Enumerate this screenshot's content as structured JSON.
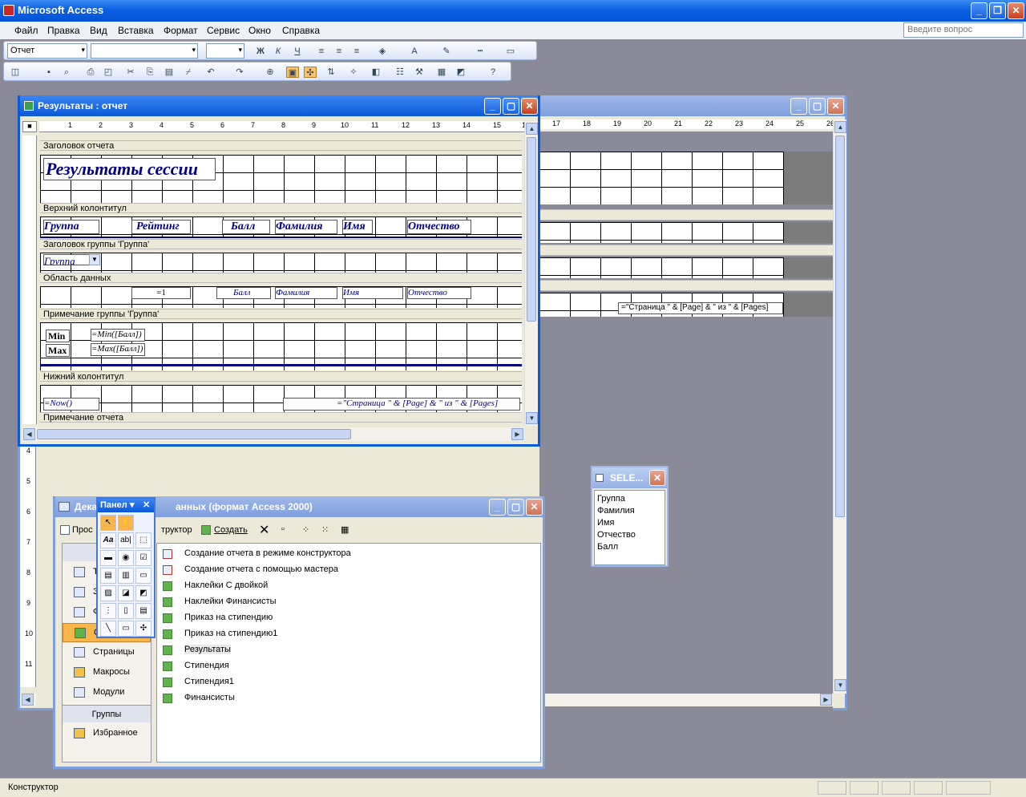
{
  "app": {
    "title": "Microsoft Access",
    "ask_placeholder": "Введите вопрос"
  },
  "menu": [
    "Файл",
    "Правка",
    "Вид",
    "Вставка",
    "Формат",
    "Сервис",
    "Окно",
    "Справка"
  ],
  "toolbar": {
    "object_combo": "Отчет"
  },
  "report_window": {
    "title": "Результаты : отчет",
    "ruler_numbers": [
      "1",
      "2",
      "3",
      "4",
      "5",
      "6",
      "7",
      "8",
      "9",
      "10",
      "11",
      "12",
      "13",
      "14",
      "15",
      "16",
      "17",
      "18",
      "19",
      "20",
      "21",
      "22",
      "23",
      "24",
      "25",
      "26"
    ],
    "sections": {
      "report_header": "Заголовок отчета",
      "page_header": "Верхний колонтитул",
      "group_header": "Заголовок группы 'Группа'",
      "detail": "Область данных",
      "group_footer": "Примечание группы 'Группа'",
      "page_footer": "Нижний колонтитул",
      "report_footer": "Примечание отчета"
    },
    "title_label": "Результаты сессии",
    "page_header_labels": [
      "Группа",
      "Рейтинг",
      "Балл",
      "Фамилия",
      "Имя",
      "Отчество"
    ],
    "group_field": "Группа",
    "detail_fields": {
      "rating": "=1",
      "ball": "Балл",
      "surname": "Фамилия",
      "name": "Имя",
      "patronymic": "Отчество"
    },
    "footer_labels": {
      "min_label": "Min",
      "max_label": "Max",
      "min_expr": "=Min([Балл])",
      "max_expr": "=Max([Балл])"
    },
    "page_footer_fields": {
      "now": "=Now()",
      "page": "=\"Страница \" & [Page] & \" из \" & [Pages]"
    },
    "back_page_expr": "=\"Страница \" & [Page] & \" из \" & [Pages]"
  },
  "db_window": {
    "title": "База данных (формат Access 2000)",
    "title_visible": "Дека",
    "title_visible_right": "анных (формат Access 2000)",
    "toolbar": {
      "preview": "Прос",
      "design": "труктор",
      "create": "Создать"
    },
    "objects_header": "Об",
    "categories": [
      {
        "label": "Т",
        "icon": "table-icon"
      },
      {
        "label": "З",
        "icon": "query-icon"
      },
      {
        "label": "Ф",
        "icon": "form-icon"
      },
      {
        "label": "О",
        "icon": "report-icon"
      },
      {
        "label": "Страницы",
        "icon": "page-icon"
      },
      {
        "label": "Макросы",
        "icon": "macro-icon"
      },
      {
        "label": "Модули",
        "icon": "module-icon"
      }
    ],
    "groups_header": "Группы",
    "favorites": "Избранное",
    "items": [
      "Создание отчета в режиме конструктора",
      "Создание отчета с помощью мастера",
      "Наклейки С двойкой",
      "Наклейки Финансисты",
      "Приказ на стипендию",
      "Приказ на стипендию1",
      "Результаты",
      "Стипендия",
      "Стипендия1",
      "Финансисты"
    ],
    "selected_item": "Результаты"
  },
  "toolbox": {
    "title": "Панел"
  },
  "field_list": {
    "title": "SELE...",
    "fields": [
      "Группа",
      "Фамилия",
      "Имя",
      "Отчество",
      "Балл"
    ]
  },
  "status_bar": {
    "text": "Конструктор"
  }
}
